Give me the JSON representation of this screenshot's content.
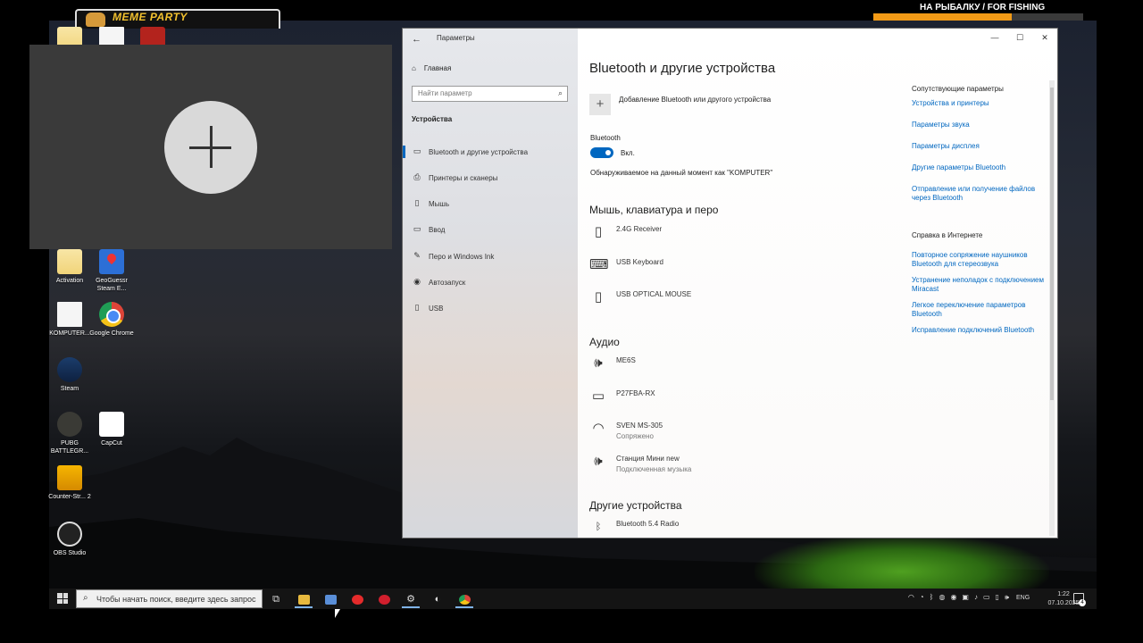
{
  "overlay": {
    "meme_banner": "MEME PARTY",
    "fishing_label": "НА РЫБАЛКУ / FOR FISHING",
    "fishing_progress": 0.66
  },
  "desktop_icons": [
    {
      "label": "Activation",
      "icon": "folder-doc-icon"
    },
    {
      "label": "GeoGuessr Steam E...",
      "icon": "geoguessr-icon"
    },
    {
      "label": "KOMPUTER...",
      "icon": "file-icon"
    },
    {
      "label": "Google Chrome",
      "icon": "chrome-icon"
    },
    {
      "label": "Steam",
      "icon": "steam-icon"
    },
    {
      "label": "PUBG BATTLEGR...",
      "icon": "pubg-icon"
    },
    {
      "label": "CapCut",
      "icon": "capcut-icon"
    },
    {
      "label": "Counter-Str... 2",
      "icon": "counter-strike-icon"
    },
    {
      "label": "OBS Studio",
      "icon": "obs-icon"
    }
  ],
  "settings": {
    "app_title": "Параметры",
    "home": "Главная",
    "search_placeholder": "Найти параметр",
    "section": "Устройства",
    "nav_items": [
      {
        "label": "Bluetooth и другие устройства",
        "icon": "bluetooth-devices-icon",
        "active": true
      },
      {
        "label": "Принтеры и сканеры",
        "icon": "printer-icon"
      },
      {
        "label": "Мышь",
        "icon": "mouse-icon"
      },
      {
        "label": "Ввод",
        "icon": "keyboard-icon"
      },
      {
        "label": "Перо и Windows Ink",
        "icon": "pen-icon"
      },
      {
        "label": "Автозапуск",
        "icon": "autoplay-icon"
      },
      {
        "label": "USB",
        "icon": "usb-icon"
      }
    ],
    "page_title": "Bluetooth и другие устройства",
    "add_device": "Добавление Bluetooth или другого устройства",
    "bluetooth_label": "Bluetooth",
    "bluetooth_state": "Вкл.",
    "discoverable": "Обнаруживаемое на данный момент как \"KOMPUTER\"",
    "sections": {
      "input": "Мышь, клавиатура и перо",
      "audio": "Аудио",
      "other": "Другие устройства"
    },
    "input_devices": [
      {
        "name": "2.4G Receiver",
        "icon": "mouse-icon"
      },
      {
        "name": "USB Keyboard",
        "icon": "keyboard-icon"
      },
      {
        "name": "USB OPTICAL MOUSE",
        "icon": "mouse-icon"
      }
    ],
    "audio_devices": [
      {
        "name": "ME6S",
        "status": "",
        "icon": "speaker-icon"
      },
      {
        "name": "P27FBA-RX",
        "status": "",
        "icon": "monitor-icon"
      },
      {
        "name": "SVEN MS-305",
        "status": "Сопряжено",
        "icon": "headset-icon"
      },
      {
        "name": "Станция Мини new",
        "status": "Подключенная музыка",
        "icon": "speaker-icon"
      }
    ],
    "other_devices": [
      {
        "name": "Bluetooth 5.4 Radio",
        "icon": "bluetooth-icon"
      }
    ],
    "related": {
      "heading": "Сопутствующие параметры",
      "links": [
        "Устройства и принтеры",
        "Параметры звука",
        "Параметры дисплея",
        "Другие параметры Bluetooth",
        "Отправление или получение файлов через Bluetooth"
      ],
      "help_heading": "Справка в Интернете",
      "help_links": [
        "Повторное сопряжение наушников Bluetooth для стереозвука",
        "Устранение неполадок с подключением Miracast",
        "Легкое переключение параметров Bluetooth",
        "Исправление подключений Bluetooth"
      ]
    }
  },
  "taskbar": {
    "search_placeholder": "Чтобы начать поиск, введите здесь запрос",
    "lang": "ENG",
    "time": "1:22",
    "date": "07.10.2025",
    "notifications": "4"
  },
  "colors": {
    "accent": "#0067c0",
    "fishing_bar": "#f29a16"
  }
}
